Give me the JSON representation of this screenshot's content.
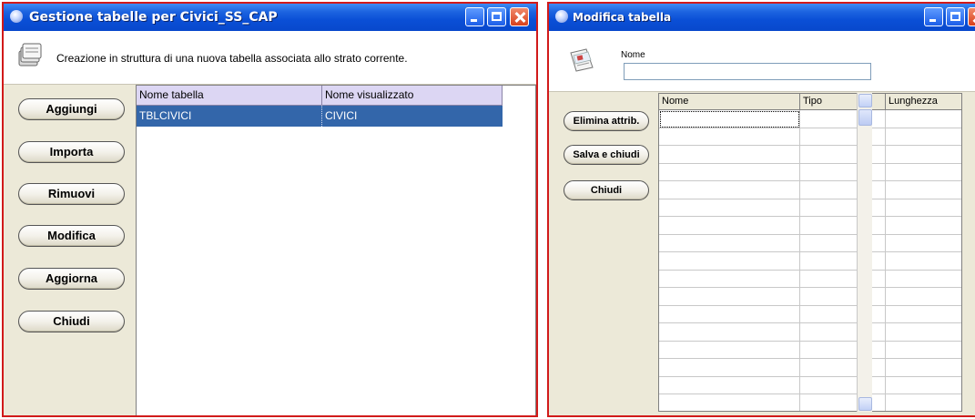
{
  "left_window": {
    "title": "Gestione tabelle per Civici_SS_CAP",
    "info_text": "Creazione in struttura di una nuova tabella associata allo strato corrente.",
    "buttons": {
      "add": "Aggiungi",
      "import": "Importa",
      "remove": "Rimuovi",
      "modify": "Modifica",
      "refresh": "Aggiorna",
      "close": "Chiudi"
    },
    "table": {
      "columns": [
        "Nome tabella",
        "Nome visualizzato"
      ],
      "rows": [
        {
          "nome_tabella": "TBLCIVICI",
          "nome_visualizzato": "CIVICI",
          "selected": true
        }
      ]
    }
  },
  "right_window": {
    "title": "Modifica tabella",
    "name_label": "Nome",
    "name_value": "",
    "buttons": {
      "delete_attribute": "Elimina attrib.",
      "save_close": "Salva e chiudi",
      "close": "Chiudi"
    },
    "attributes_table": {
      "columns": [
        "Nome",
        "Tipo",
        "Lunghezza"
      ],
      "rows": []
    }
  },
  "colors": {
    "titlebar": "#0a4fd6",
    "window_border": "#d11a1a",
    "selection": "#3366aa",
    "header_bg": "#dcd6f3",
    "window_bg": "#ece9d8"
  },
  "icons": [
    "window-app-icon",
    "minimize-icon",
    "maximize-icon",
    "close-icon",
    "table-stack-icon",
    "document-icon",
    "scroll-up-icon",
    "scroll-down-icon"
  ]
}
